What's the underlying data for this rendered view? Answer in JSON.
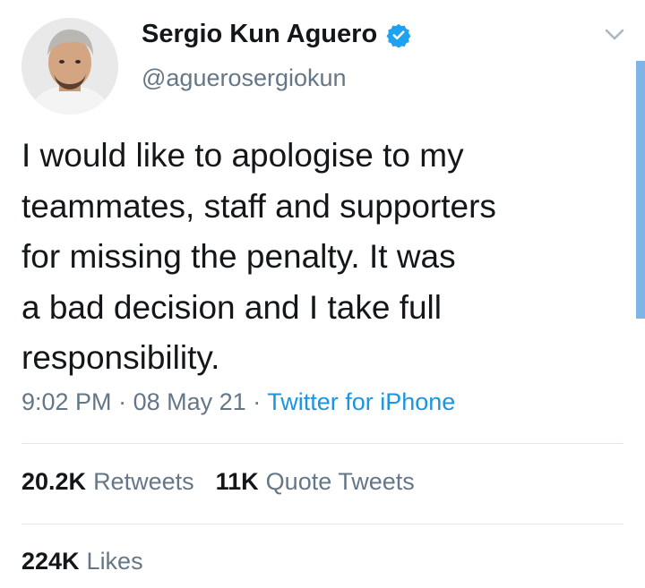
{
  "user": {
    "display_name": "Sergio Kun Aguero",
    "handle": "@aguerosergiokun"
  },
  "tweet": {
    "text": "I would like to apologise to my\nteammates, staff and supporters\nfor missing the penalty. It was\na bad decision and I take full\nresponsibility.",
    "time": "9:02 PM",
    "separator": "·",
    "date": "08 May 21",
    "source": "Twitter for iPhone"
  },
  "stats": {
    "retweets_count": "20.2K",
    "retweets_label": "Retweets",
    "quotes_count": "11K",
    "quotes_label": "Quote Tweets",
    "likes_count": "224K",
    "likes_label": "Likes"
  },
  "colors": {
    "accent": "#1b95e0",
    "verified": "#1da1f2",
    "muted_text": "#657786",
    "divider": "#e1e8ed"
  },
  "icons": {
    "verified": "verified-badge-icon",
    "menu": "chevron-down-icon"
  }
}
